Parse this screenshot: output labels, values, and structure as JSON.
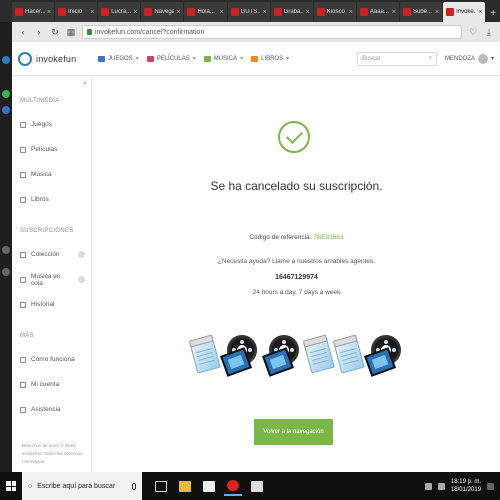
{
  "browser": {
    "tabs": [
      {
        "label": "Hacer..."
      },
      {
        "label": "Inicio"
      },
      {
        "label": "Lucra..."
      },
      {
        "label": "Navega..."
      },
      {
        "label": "Hola..."
      },
      {
        "label": "GUTS..."
      },
      {
        "label": "Graba..."
      },
      {
        "label": "Kiosco"
      },
      {
        "label": "Aaaa..."
      },
      {
        "label": "Sube..."
      },
      {
        "label": "Invoke..."
      }
    ],
    "active_tab_label": "Invoke...",
    "url": "invokefun.com/cancel?confirmation"
  },
  "site": {
    "logo_text": "invokefun",
    "nav": [
      {
        "label": "JUEGOS",
        "color": "#3b6fd1"
      },
      {
        "label": "PELÍCULAS",
        "color": "#d43a6b"
      },
      {
        "label": "MÚSICA",
        "color": "#7ab648"
      },
      {
        "label": "LIBROS",
        "color": "#f08c1e"
      }
    ],
    "search_placeholder": "Buscar",
    "user_name": "MENDOZA"
  },
  "sidebar": {
    "multimedia_title": "MULTIMEDIA",
    "multimedia_items": [
      {
        "label": "Juegos"
      },
      {
        "label": "Películas"
      },
      {
        "label": "Música"
      },
      {
        "label": "Libros"
      }
    ],
    "subscriptions_title": "SUSCRIPCIONES",
    "subscription_items": [
      {
        "label": "Colección"
      },
      {
        "label": "Música en cola"
      },
      {
        "label": "Historial"
      }
    ],
    "more_title": "MÁS",
    "more_items": [
      {
        "label": "Cómo funciona"
      },
      {
        "label": "Mi cuenta"
      },
      {
        "label": "Asistencia"
      }
    ],
    "footer": "Derechos de autor © 2018, invokefun. Todos los derechos reservados."
  },
  "main": {
    "headline": "Se ha cancelado su suscripción.",
    "reference_label": "Código de referencia:",
    "reference_code": "7BE01663",
    "help_text": "¿Necesita ayuda? Llame a nuestros amables agentes.",
    "phone": "16467129974",
    "hours": "24 hours a day, 7 days a week",
    "cta_label": "Volver a la navegación"
  },
  "taskbar": {
    "search_text": "Escribe aquí para buscar",
    "time": "18:19 p. m.",
    "date": "18/01/2019"
  }
}
